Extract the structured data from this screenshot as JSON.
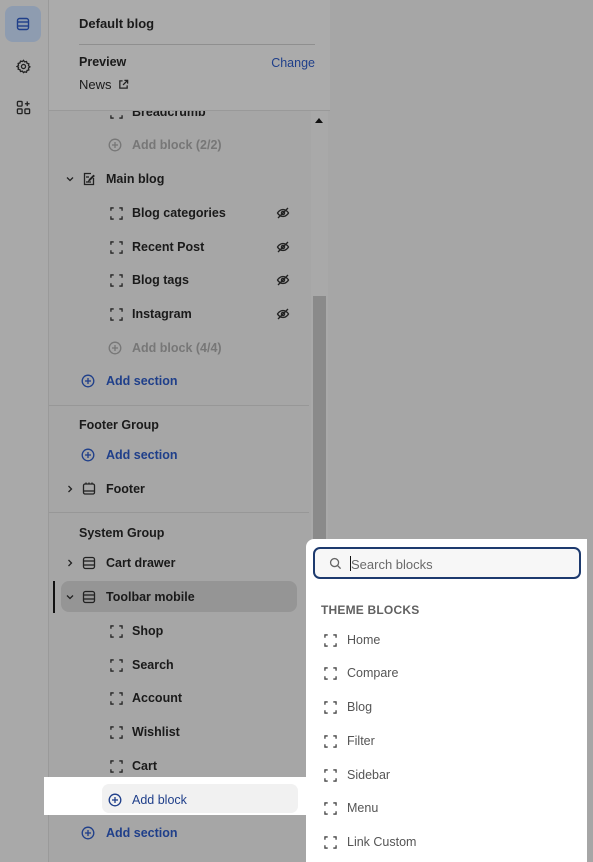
{
  "rail": {
    "icons": [
      "sections-icon",
      "settings-icon",
      "apps-icon"
    ]
  },
  "header": {
    "title": "Default blog",
    "preview_label": "Preview",
    "change_label": "Change",
    "preview_value": "News"
  },
  "tree": {
    "breadcrumb_label": "Breadcrumb",
    "add_block_top": "Add block (2/2)",
    "main_blog": {
      "label": "Main blog",
      "blocks": [
        "Blog categories",
        "Recent Post",
        "Blog tags",
        "Instagram"
      ],
      "add_block": "Add block (4/4)"
    },
    "add_section_1": "Add section",
    "footer_group": {
      "title": "Footer Group",
      "add_section": "Add section",
      "footer": "Footer"
    },
    "system_group": {
      "title": "System Group",
      "cart_drawer": "Cart drawer",
      "toolbar_mobile": "Toolbar mobile",
      "blocks": [
        "Shop",
        "Search",
        "Account",
        "Wishlist",
        "Cart"
      ],
      "add_block": "Add block",
      "add_section": "Add section"
    }
  },
  "popup": {
    "search_placeholder": "Search blocks",
    "section_title": "THEME BLOCKS",
    "items": [
      "Home",
      "Compare",
      "Blog",
      "Filter",
      "Sidebar",
      "Menu",
      "Link Custom"
    ]
  },
  "colors": {
    "accent": "#1f3f8a",
    "panel_bg": "#a6a6a6",
    "popup_bg": "#ffffff",
    "search_border": "#1d3a6e"
  }
}
